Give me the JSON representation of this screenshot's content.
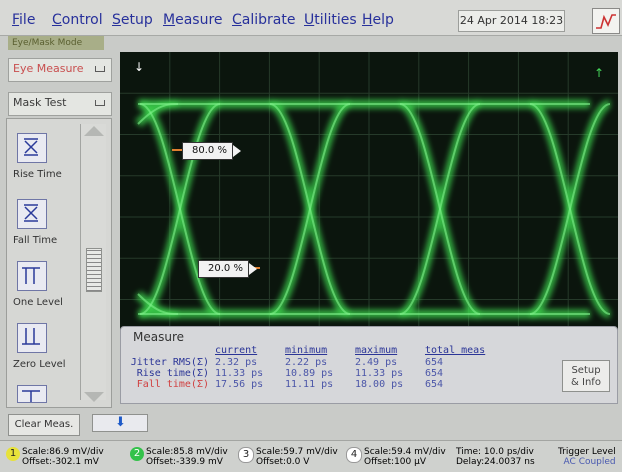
{
  "menu": [
    "File",
    "Control",
    "Setup",
    "Measure",
    "Calibrate",
    "Utilities",
    "Help"
  ],
  "datetime": "24 Apr 2014   18:23",
  "mode_tab": "Eye/Mask Mode",
  "dropdowns": {
    "eye_measure": "Eye Measure",
    "mask_test": "Mask Test"
  },
  "tools": [
    {
      "label": "Rise Time"
    },
    {
      "label": "Fall Time"
    },
    {
      "label": "One Level"
    },
    {
      "label": "Zero Level"
    }
  ],
  "cursors": {
    "upper": "80.0 %",
    "lower": "20.0 %"
  },
  "measure": {
    "title": "Measure",
    "headers": [
      "current",
      "minimum",
      "maximum",
      "total meas"
    ],
    "rows": [
      {
        "name": "Jitter RMS(Σ)",
        "current": "2.32 ps",
        "minimum": "2.22 ps",
        "maximum": "2.49 ps",
        "total": "654",
        "color": "#2b3597"
      },
      {
        "name": "Rise time(Σ)",
        "current": "11.33 ps",
        "minimum": "10.89 ps",
        "maximum": "11.33 ps",
        "total": "654",
        "color": "#2b3597"
      },
      {
        "name": "Fall time(Σ)",
        "current": "17.56 ps",
        "minimum": "11.11 ps",
        "maximum": "18.00 ps",
        "total": "654",
        "color": "#d04040"
      }
    ],
    "setup_line1": "Setup",
    "setup_line2": "& Info"
  },
  "clear_label": "Clear Meas.",
  "channels": [
    {
      "num": "1",
      "scale": "Scale:86.9 mV/div",
      "offset": "Offset:-302.1 mV",
      "color": "#e7e23a"
    },
    {
      "num": "2",
      "scale": "Scale:85.8 mV/div",
      "offset": "Offset:-339.9 mV",
      "color": "#33c24a"
    },
    {
      "num": "3",
      "scale": "Scale:59.7 mV/div",
      "offset": "Offset:0.0 V",
      "color": "#ffffff"
    },
    {
      "num": "4",
      "scale": "Scale:59.4 mV/div",
      "offset": "Offset:100 µV",
      "color": "#ffffff"
    }
  ],
  "time": {
    "scale": "Time: 10.0 ps/div",
    "delay": "Delay:24.0037 ns"
  },
  "trigger": {
    "level": "Trigger Level",
    "coupling": "AC Coupled"
  },
  "colors": {
    "trace": "#3fd94f",
    "accent": "#27309b"
  }
}
